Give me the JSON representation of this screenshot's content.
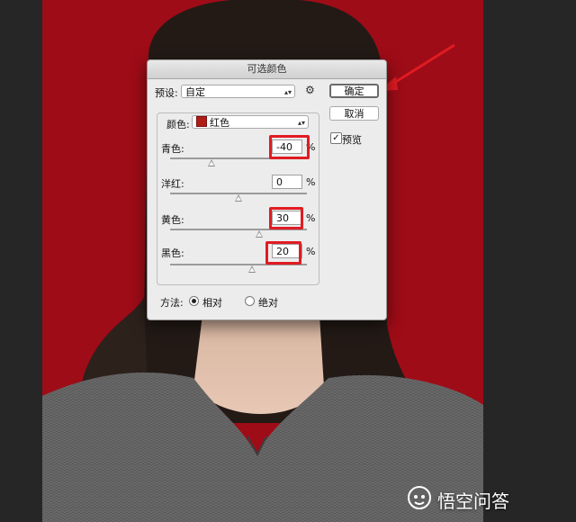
{
  "dialog": {
    "title": "可选颜色",
    "preset_label": "预设:",
    "preset_value": "自定",
    "ok_label": "确定",
    "cancel_label": "取消",
    "preview_label": "预览",
    "preview_checked": true,
    "colors_label": "颜色:",
    "colors_value": "红色",
    "percent_unit": "%",
    "sliders": [
      {
        "label": "青色:",
        "value": "-40",
        "level": -40
      },
      {
        "label": "洋红:",
        "value": "0",
        "level": 0
      },
      {
        "label": "黄色:",
        "value": "30",
        "level": 30
      },
      {
        "label": "黑色:",
        "value": "20",
        "level": 20
      }
    ],
    "method_label": "方法:",
    "method_relative": "相对",
    "method_absolute": "绝对",
    "method_selected": "相对"
  },
  "watermark": {
    "text": "悟空问答"
  },
  "colors": {
    "background_red": "#9e0c17",
    "highlight": "#e11b22",
    "sweater": "#5a5a5a"
  }
}
